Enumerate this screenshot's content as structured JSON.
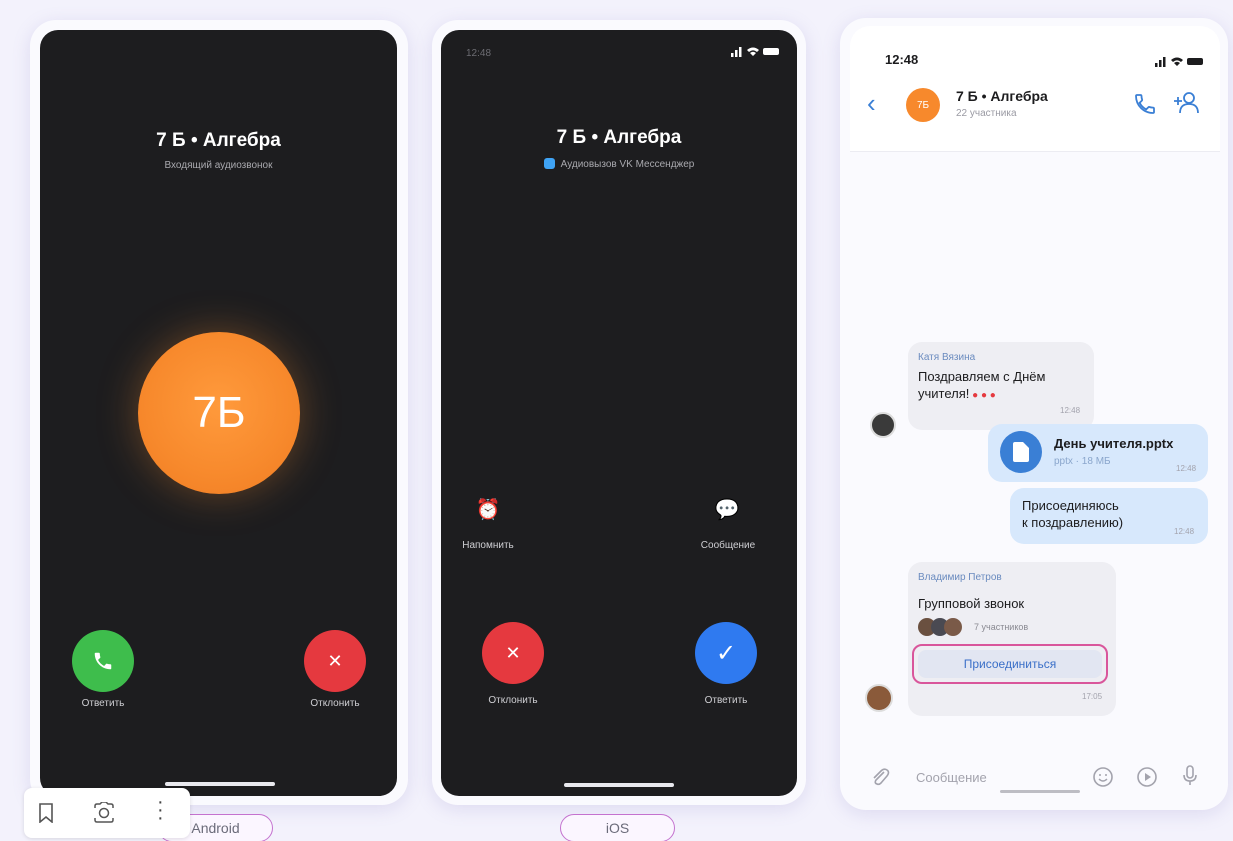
{
  "android": {
    "title": "7 Б • Алгебра",
    "subtitle": "Входящий аудиозвонок",
    "avatar_text": "7Б",
    "answer_label": "Ответить",
    "decline_label": "Отклонить",
    "platform_label": "Android"
  },
  "ios": {
    "status_time": "12:48",
    "title": "7 Б • Алгебра",
    "subtitle": "Аудиовызов VK Мессенджер",
    "remind_label": "Напомнить",
    "message_label": "Сообщение",
    "decline_label": "Отклонить",
    "answer_label": "Ответить",
    "platform_label": "iOS"
  },
  "chat": {
    "status_time": "12:48",
    "avatar_text": "7Б",
    "title": "7 Б • Алгебра",
    "members": "22 участника",
    "messages": {
      "m1_sender": "Катя Вязина",
      "m1_text_1": "Поздравляем с Днём",
      "m1_text_2": "учителя!",
      "m1_time": "12:48",
      "file_name": "День учителя.pptx",
      "file_meta": "pptx · 18 МБ",
      "file_time": "12:48",
      "m3_text_1": "Присоединяюсь",
      "m3_text_2": "к поздравлению)",
      "m3_time": "12:48",
      "call_sender": "Владимир Петров",
      "call_title": "Групповой звонок",
      "call_members": "7 участников",
      "join_label": "Присоединиться",
      "call_time": "17:05"
    },
    "input_placeholder": "Сообщение"
  },
  "colors": {
    "accent_orange": "#f7892c",
    "answer_green": "#3ebd4c",
    "decline_red": "#e5393f",
    "answer_blue": "#2f7af0",
    "highlight_pink": "#d9569b"
  }
}
